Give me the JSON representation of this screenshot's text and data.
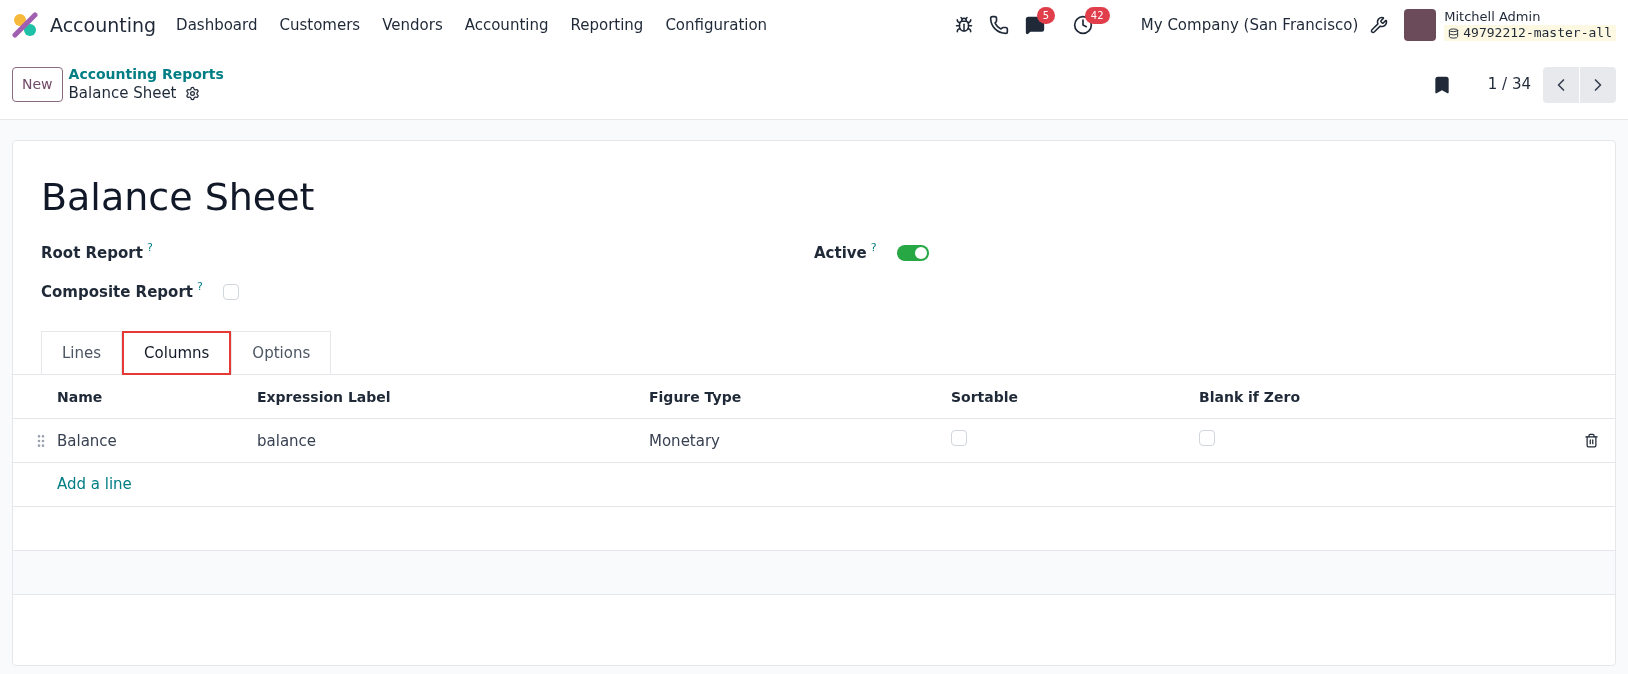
{
  "navbar": {
    "app_name": "Accounting",
    "menu": [
      "Dashboard",
      "Customers",
      "Vendors",
      "Accounting",
      "Reporting",
      "Configuration"
    ],
    "messages_badge": "5",
    "activities_badge": "42",
    "company": "My Company (San Francisco)",
    "user_name": "Mitchell Admin",
    "database": "49792212-master-all"
  },
  "control_panel": {
    "new_button": "New",
    "breadcrumb_parent": "Accounting Reports",
    "breadcrumb_current": "Balance Sheet",
    "pager": "1 / 34"
  },
  "form": {
    "title": "Balance Sheet",
    "fields": [
      {
        "kind": "text",
        "label": "Root Report",
        "help": "?"
      },
      {
        "kind": "toggle",
        "label": "Active",
        "help": "?",
        "on": true
      },
      {
        "kind": "checkbox",
        "label": "Composite Report",
        "help": "?",
        "checked": false
      }
    ],
    "tabs": [
      {
        "label": "Lines",
        "selected": false
      },
      {
        "label": "Columns",
        "selected": true,
        "highlighted": true
      },
      {
        "label": "Options",
        "selected": false
      }
    ],
    "table": {
      "columns": [
        "Name",
        "Expression Label",
        "Figure Type",
        "Sortable",
        "Blank if Zero"
      ],
      "rows": [
        {
          "name": "Balance",
          "expression_label": "balance",
          "figure_type": "Monetary",
          "sortable": false,
          "blank_if_zero": false
        }
      ],
      "add_line": "Add a line"
    }
  }
}
